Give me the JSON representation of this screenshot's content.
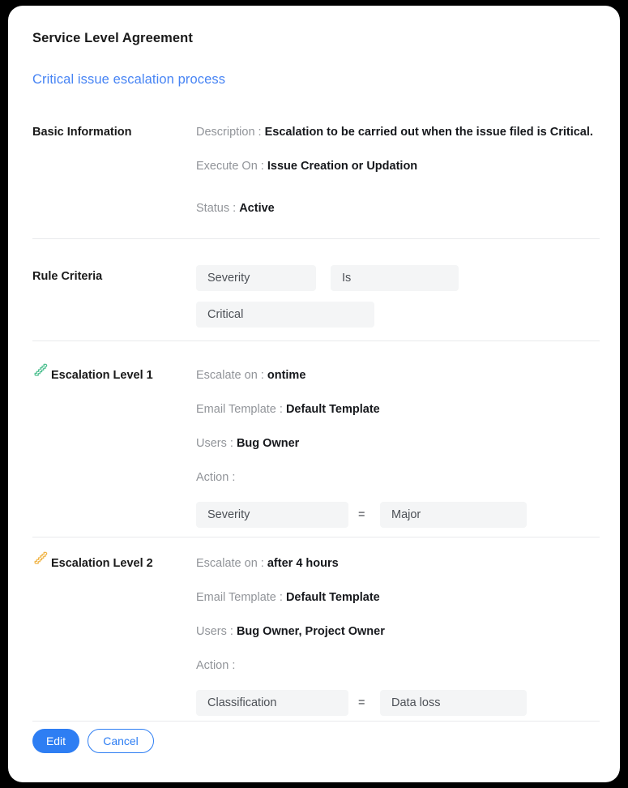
{
  "header": {
    "page_title": "Service Level Agreement",
    "rule_name": "Critical issue escalation process"
  },
  "basic_information": {
    "label": "Basic Information",
    "fields": [
      {
        "key": "Description :",
        "value": "Escalation to be carried out when the issue filed is Critical."
      },
      {
        "key": "Execute On :",
        "value": "Issue Creation or Updation"
      },
      {
        "key": "Status :",
        "value": "Active"
      }
    ]
  },
  "rule_criteria": {
    "label": "Rule Criteria",
    "field": "Severity",
    "condition": "Is",
    "value": "Critical"
  },
  "escalation_levels": [
    {
      "icon": "escalator-icon",
      "icon_color": "#4cbf8f",
      "label": "Escalation Level 1",
      "fields": [
        {
          "key": "Escalate on :",
          "value": "ontime"
        },
        {
          "key": "Email Template :",
          "value": "Default Template"
        },
        {
          "key": "Users :",
          "value": "Bug Owner"
        },
        {
          "key": "Action :",
          "value": ""
        }
      ],
      "action": {
        "field": "Severity",
        "operator": "=",
        "value": "Major"
      }
    },
    {
      "icon": "escalator-icon",
      "icon_color": "#f0b446",
      "label": "Escalation Level 2",
      "fields": [
        {
          "key": "Escalate on :",
          "value": "after 4 hours"
        },
        {
          "key": "Email Template :",
          "value": "Default Template"
        },
        {
          "key": "Users :",
          "value": "Bug Owner, Project Owner"
        },
        {
          "key": "Action :",
          "value": ""
        }
      ],
      "action": {
        "field": "Classification",
        "operator": "=",
        "value": "Data loss"
      }
    }
  ],
  "footer": {
    "edit_label": "Edit",
    "cancel_label": "Cancel"
  },
  "colors": {
    "accent_link": "#4784f4",
    "primary_button": "#2e7ef3",
    "level1_icon": "#4cbf8f",
    "level2_icon": "#f0b446",
    "pill_background": "#f4f5f6",
    "divider": "#e9eaec"
  }
}
